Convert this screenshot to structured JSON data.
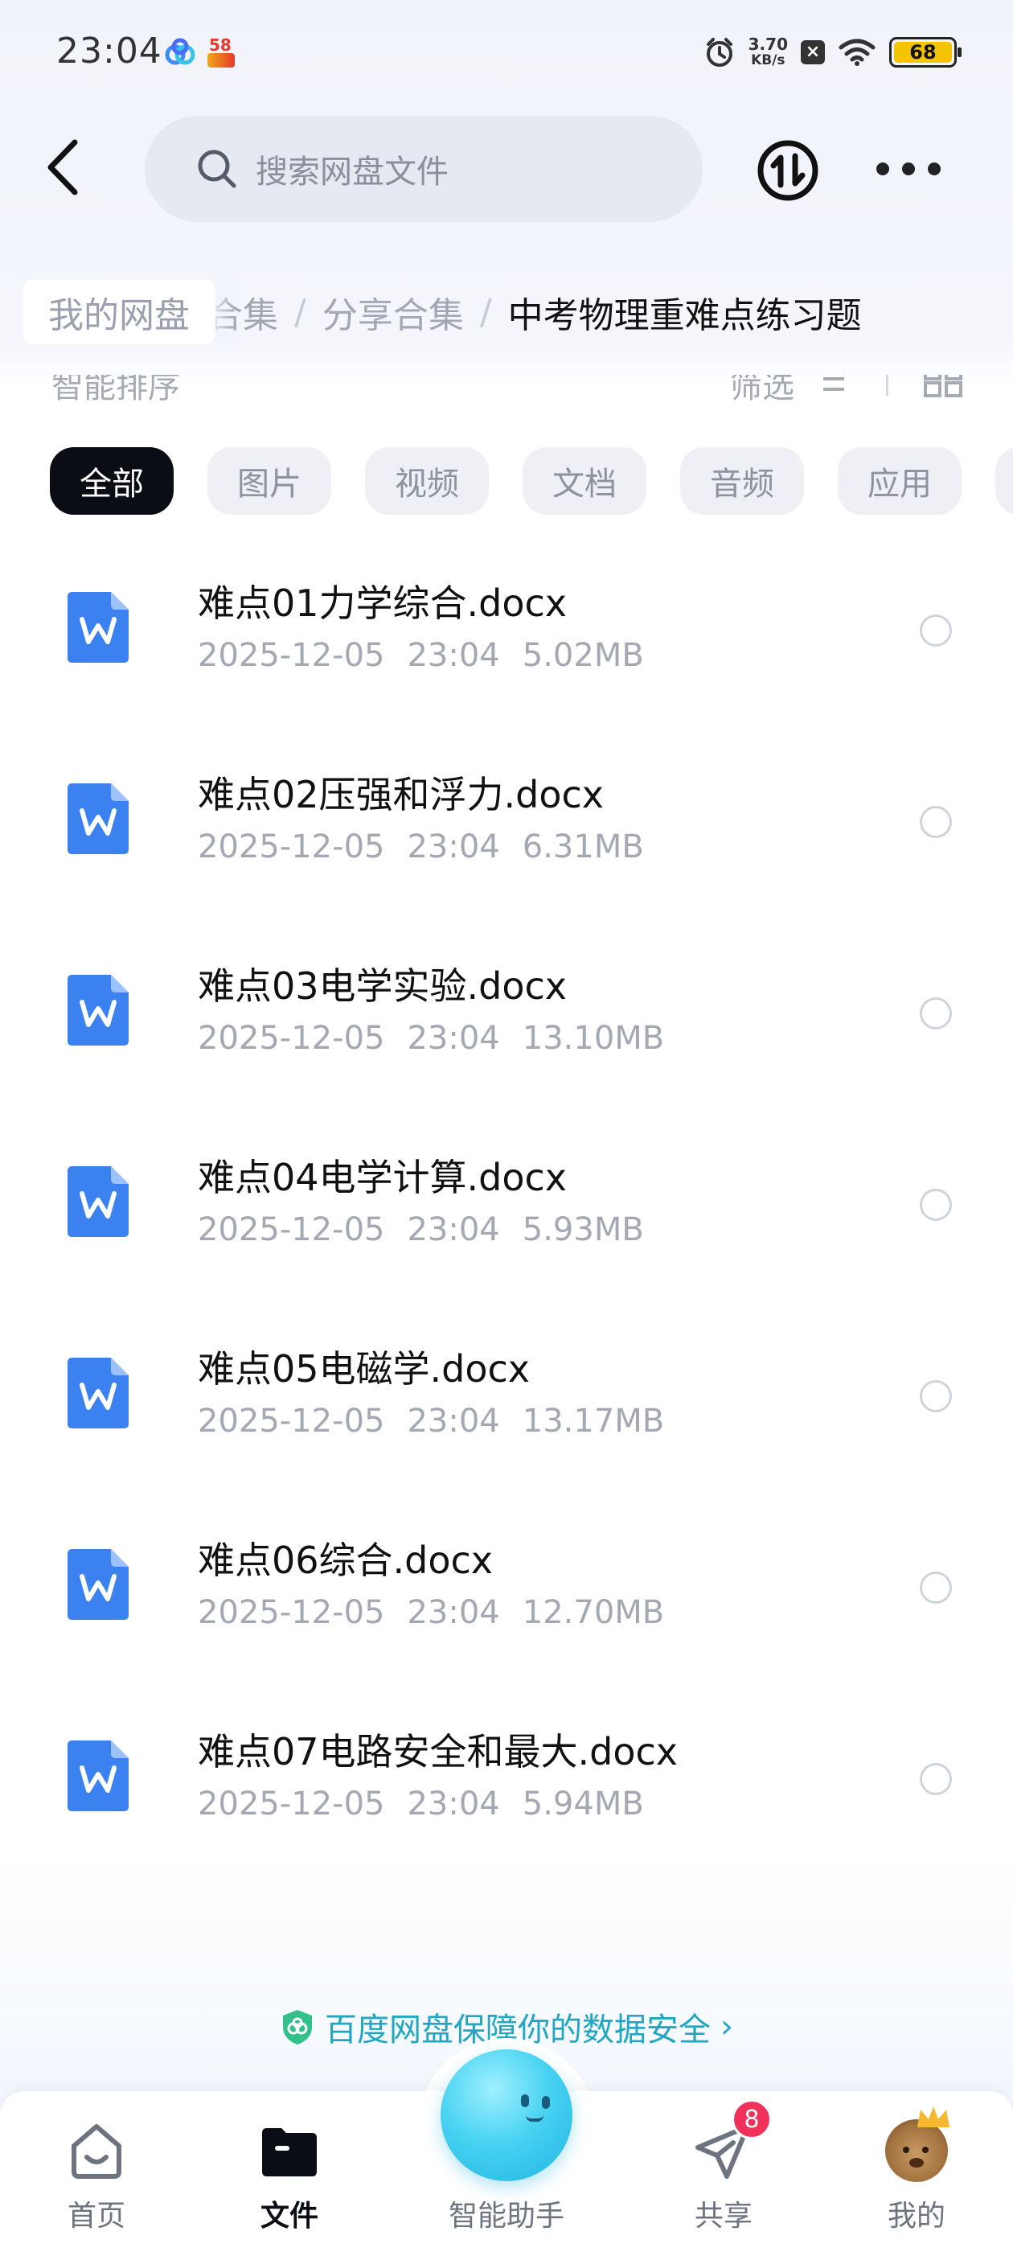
{
  "status_bar": {
    "time": "23:04",
    "net_speed_value": "3.70",
    "net_speed_unit": "KB/s",
    "battery": "68",
    "app_icon_badge": "58"
  },
  "header": {
    "search_placeholder": "搜索网盘文件"
  },
  "breadcrumb": {
    "root": "我的网盘",
    "partial": "合集",
    "separator": "/",
    "middle": "分享合集",
    "current": "中考物理重难点练习题"
  },
  "sort_bar": {
    "sort_label": "智能排序",
    "filter_label": "筛选"
  },
  "chips": [
    {
      "label": "全部",
      "active": true
    },
    {
      "label": "图片",
      "active": false
    },
    {
      "label": "视频",
      "active": false
    },
    {
      "label": "文档",
      "active": false
    },
    {
      "label": "音频",
      "active": false
    },
    {
      "label": "应用",
      "active": false
    }
  ],
  "files": [
    {
      "name": "难点01力学综合.docx",
      "date": "2025-12-05",
      "time": "23:04",
      "size": "5.02MB",
      "icon": "word-doc-icon"
    },
    {
      "name": "难点02压强和浮力.docx",
      "date": "2025-12-05",
      "time": "23:04",
      "size": "6.31MB",
      "icon": "word-doc-icon"
    },
    {
      "name": "难点03电学实验.docx",
      "date": "2025-12-05",
      "time": "23:04",
      "size": "13.10MB",
      "icon": "word-doc-icon"
    },
    {
      "name": "难点04电学计算.docx",
      "date": "2025-12-05",
      "time": "23:04",
      "size": "5.93MB",
      "icon": "word-doc-icon"
    },
    {
      "name": "难点05电磁学.docx",
      "date": "2025-12-05",
      "time": "23:04",
      "size": "13.17MB",
      "icon": "word-doc-icon"
    },
    {
      "name": "难点06综合.docx",
      "date": "2025-12-05",
      "time": "23:04",
      "size": "12.70MB",
      "icon": "word-doc-icon"
    },
    {
      "name": "难点07电路安全和最大.docx",
      "date": "2025-12-05",
      "time": "23:04",
      "size": "5.94MB",
      "icon": "word-doc-icon"
    }
  ],
  "security_notice": "百度网盘保障你的数据安全",
  "bottom_nav": {
    "home": "首页",
    "files": "文件",
    "assistant": "智能助手",
    "share": "共享",
    "share_badge": "8",
    "mine": "我的"
  },
  "colors": {
    "accent_teal": "#22a7c2",
    "word_blue": "#3b82f0",
    "badge_red": "#f0315a",
    "chip_active": "#0b0d14"
  }
}
